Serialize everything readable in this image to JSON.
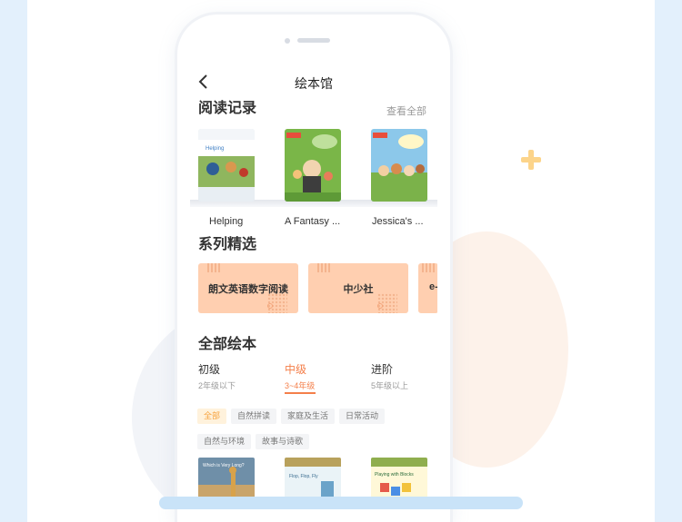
{
  "nav": {
    "title": "绘本馆",
    "back_icon": "chevron-left-icon"
  },
  "records": {
    "title": "阅读记录",
    "view_all": "查看全部",
    "books": [
      {
        "title": "Helping",
        "cover_text": "Helping"
      },
      {
        "title": "A Fantasy ...",
        "cover_text": ""
      },
      {
        "title": "Jessica's ...",
        "cover_text": ""
      }
    ]
  },
  "series": {
    "title": "系列精选",
    "cards": [
      {
        "label": "朗文英语数字阅读"
      },
      {
        "label": "中少社"
      },
      {
        "label": "e-"
      }
    ]
  },
  "all_books": {
    "title": "全部绘本",
    "levels": [
      {
        "name": "初级",
        "sub": "2年级以下",
        "active": false
      },
      {
        "name": "中级",
        "sub": "3~4年级",
        "active": true
      },
      {
        "name": "进阶",
        "sub": "5年级以上",
        "active": false
      }
    ],
    "tags": [
      "全部",
      "自然拼读",
      "家庭及生活",
      "日常活动",
      "自然与环境",
      "故事与诗歌"
    ],
    "active_tag": "全部",
    "grid_books": [
      {
        "cover_text": "Which is Very Long?"
      },
      {
        "cover_text": "Flop, Flop, Fly"
      },
      {
        "cover_text": "Playing with Blocks"
      }
    ]
  },
  "colors": {
    "accent": "#f47f4a",
    "tag_active": "#f7a33e",
    "card_bg": "#ffcfb0",
    "page_bg": "#e3f0fc"
  }
}
